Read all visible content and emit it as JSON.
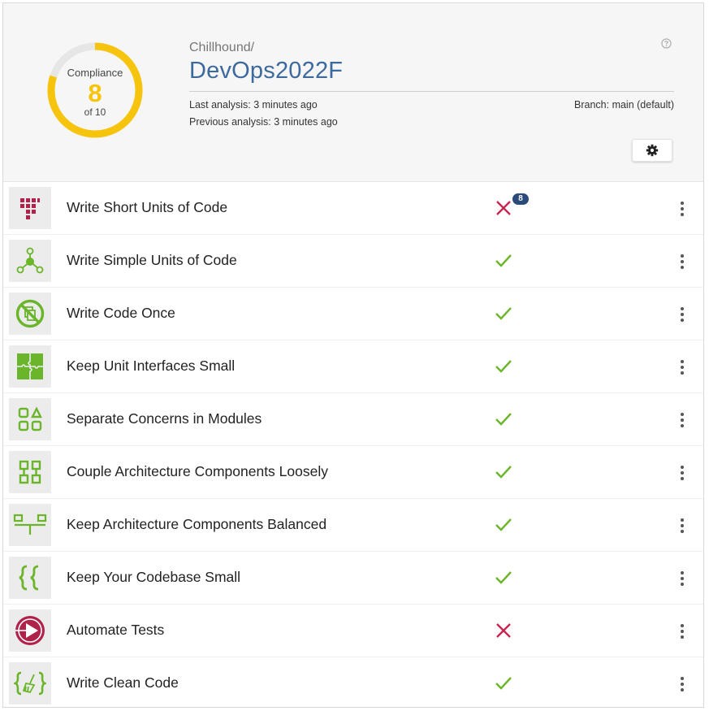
{
  "colors": {
    "accent": "#3d6a9d",
    "gauge": "#f6c40c",
    "green": "#6bb52b",
    "red": "#c7254e",
    "badge": "#2b4a7a"
  },
  "header": {
    "compliance": {
      "label": "Compliance",
      "score": "8",
      "of_label": "of 10",
      "fraction": 0.8
    },
    "owner": "Chillhound/",
    "repository": "DevOps2022F",
    "last_analysis": "Last analysis: 3 minutes ago",
    "previous_analysis": "Previous analysis: 3 minutes ago",
    "branch": "Branch: main (default)",
    "help_icon": "question-circle-icon",
    "settings_icon": "gear-icon"
  },
  "guidelines": [
    {
      "label": "Write Short Units of Code",
      "icon": "short-units-icon",
      "status": "fail",
      "badge": "8"
    },
    {
      "label": "Write Simple Units of Code",
      "icon": "simple-units-icon",
      "status": "pass"
    },
    {
      "label": "Write Code Once",
      "icon": "code-once-icon",
      "status": "pass"
    },
    {
      "label": "Keep Unit Interfaces Small",
      "icon": "puzzle-icon",
      "status": "pass"
    },
    {
      "label": "Separate Concerns in Modules",
      "icon": "modules-icon",
      "status": "pass"
    },
    {
      "label": "Couple Architecture Components Loosely",
      "icon": "components-icon",
      "status": "pass"
    },
    {
      "label": "Keep Architecture Components Balanced",
      "icon": "balance-icon",
      "status": "pass"
    },
    {
      "label": "Keep Your Codebase Small",
      "icon": "braces-icon",
      "status": "pass"
    },
    {
      "label": "Automate Tests",
      "icon": "play-icon",
      "status": "fail"
    },
    {
      "label": "Write Clean Code",
      "icon": "broom-braces-icon",
      "status": "pass"
    }
  ]
}
